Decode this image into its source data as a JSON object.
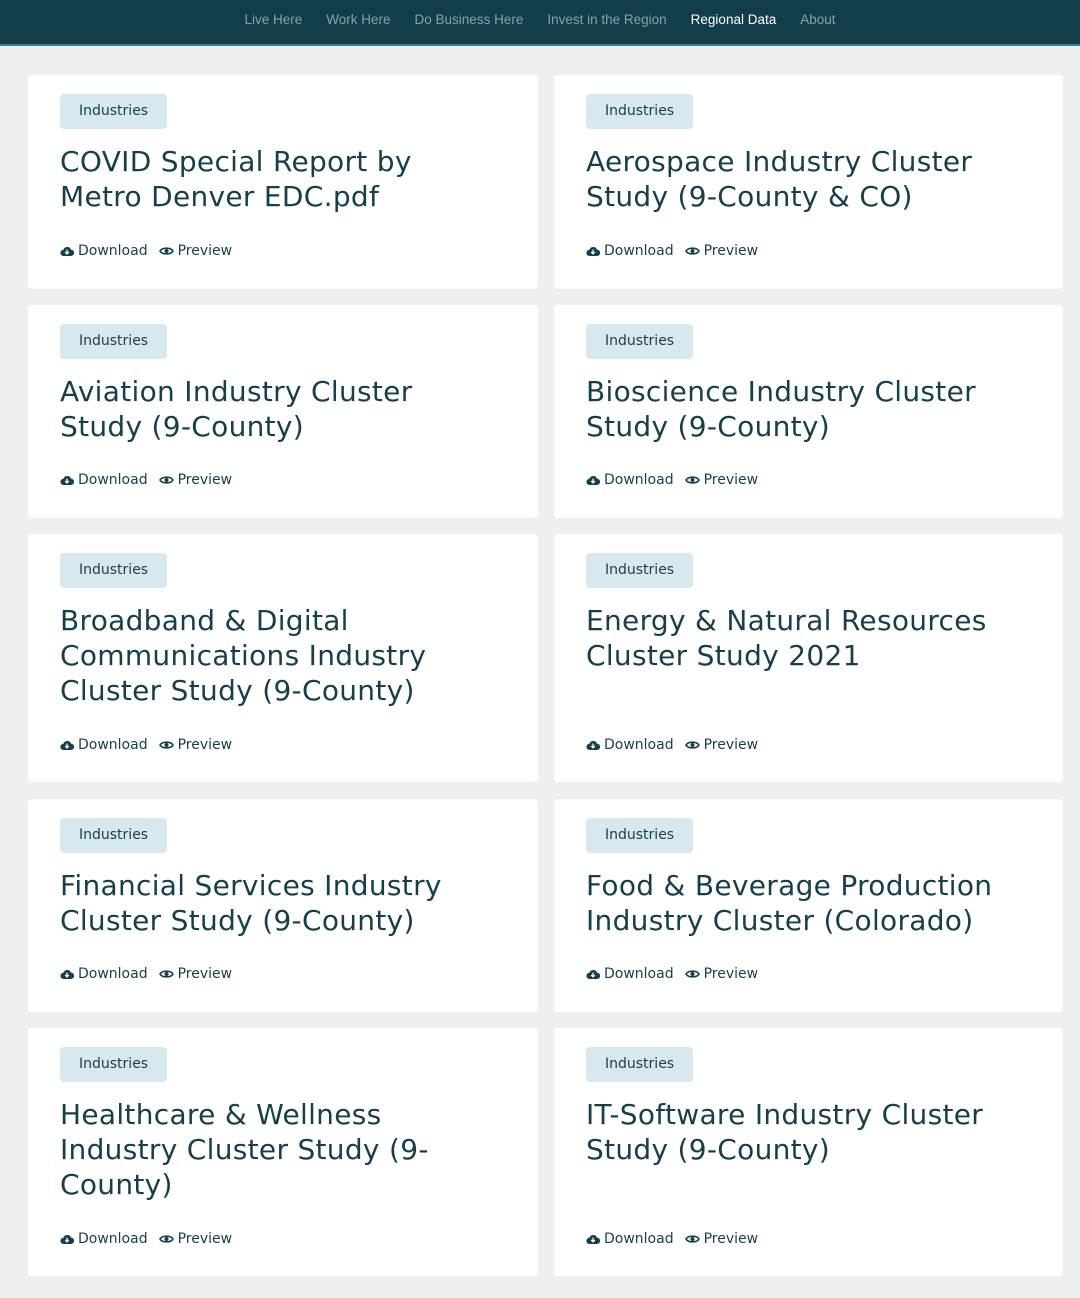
{
  "nav": {
    "items": [
      {
        "label": "Live Here"
      },
      {
        "label": "Work Here"
      },
      {
        "label": "Do Business Here"
      },
      {
        "label": "Invest in the Region"
      },
      {
        "label": "Regional Data"
      },
      {
        "label": "About"
      }
    ]
  },
  "colors": {
    "topbar": "#123d4b",
    "accent_text": "#163f4c",
    "badge_bg": "#d7e9ef",
    "page_bg": "#eef0ef"
  },
  "cards": [
    {
      "category": "Industries",
      "title": "COVID Special Report by Metro Denver EDC.pdf",
      "download_label": "Download",
      "preview_label": "Preview"
    },
    {
      "category": "Industries",
      "title": "Aerospace Industry Cluster Study (9-County & CO)",
      "download_label": "Download",
      "preview_label": "Preview"
    },
    {
      "category": "Industries",
      "title": "Aviation Industry Cluster Study (9-County)",
      "download_label": "Download",
      "preview_label": "Preview"
    },
    {
      "category": "Industries",
      "title": "Bioscience Industry Cluster Study (9-County)",
      "download_label": "Download",
      "preview_label": "Preview"
    },
    {
      "category": "Industries",
      "title": "Broadband & Digital Communications Industry Cluster Study (9-County)",
      "download_label": "Download",
      "preview_label": "Preview"
    },
    {
      "category": "Industries",
      "title": "Energy & Natural Resources Cluster Study 2021",
      "download_label": "Download",
      "preview_label": "Preview"
    },
    {
      "category": "Industries",
      "title": "Financial Services Industry Cluster Study (9-County)",
      "download_label": "Download",
      "preview_label": "Preview"
    },
    {
      "category": "Industries",
      "title": "Food & Beverage Production Industry Cluster (Colorado)",
      "download_label": "Download",
      "preview_label": "Preview"
    },
    {
      "category": "Industries",
      "title": "Healthcare & Wellness Industry Cluster Study (9-County)",
      "download_label": "Download",
      "preview_label": "Preview"
    },
    {
      "category": "Industries",
      "title": "IT-Software Industry Cluster Study (9-County)",
      "download_label": "Download",
      "preview_label": "Preview"
    }
  ]
}
